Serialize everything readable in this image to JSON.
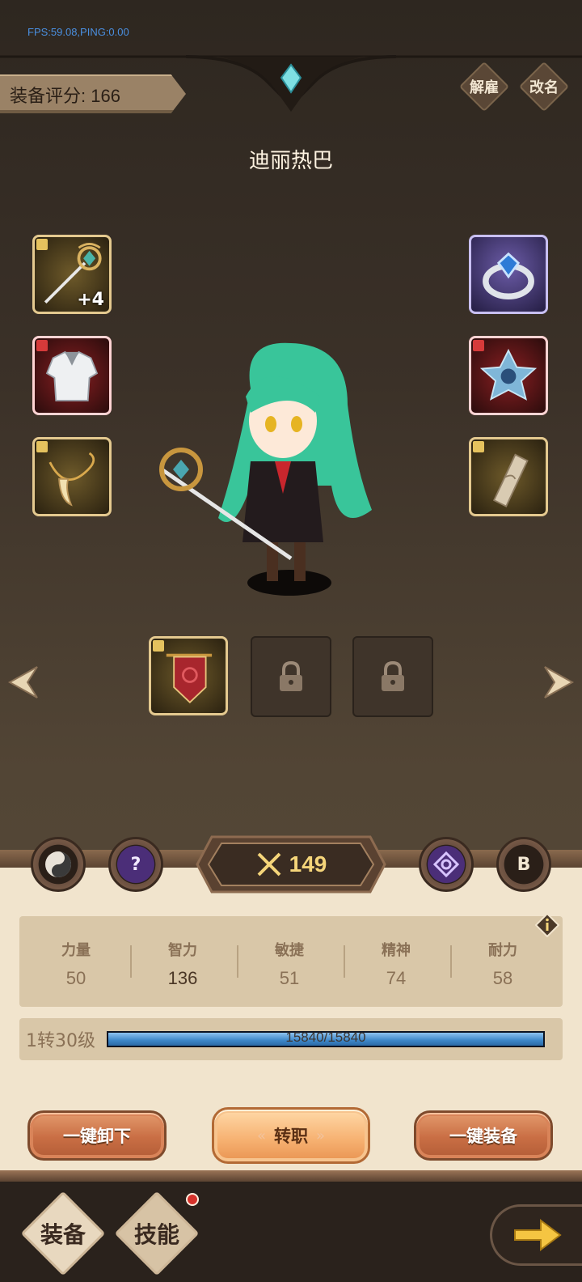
{
  "debug": {
    "fps_text": "FPS:59.08,PING:0.00"
  },
  "header": {
    "score_label": "装备评分: 166",
    "dismiss_label": "解雇",
    "rename_label": "改名",
    "hero_name": "迪丽热巴"
  },
  "equipment": {
    "weapon_enhance": "+4",
    "weapon": "staff-icon",
    "armor": "chest-armor-icon",
    "necklace": "fang-necklace-icon",
    "ring": "sapphire-ring-icon",
    "gem": "star-gem-icon",
    "bracer": "scroll-bracer-icon",
    "extra_slot_1": "banner-icon",
    "extra_slot_2": "lock-icon",
    "extra_slot_3": "lock-icon"
  },
  "round_buttons": {
    "left_1": "yinyang-icon",
    "left_2": "question-icon",
    "right_1": "rune-icon",
    "right_2_label": "B"
  },
  "power": {
    "value": "149",
    "icon": "crossed-swords-icon"
  },
  "attributes": [
    {
      "name": "力量",
      "value": "50"
    },
    {
      "name": "智力",
      "value": "136"
    },
    {
      "name": "敏捷",
      "value": "51"
    },
    {
      "name": "精神",
      "value": "74"
    },
    {
      "name": "耐力",
      "value": "58"
    }
  ],
  "level": {
    "label": "1转30级",
    "xp_text": "15840/15840",
    "xp_fraction": 1.0
  },
  "actions": {
    "unequip_all": "一键卸下",
    "change_class": "转职",
    "equip_all": "一键装备"
  },
  "nav": {
    "equip_tab": "装备",
    "skill_tab": "技能"
  },
  "colors": {
    "accent_gold": "#f5d57a",
    "xp_blue": "#3d86c8",
    "notification_red": "#d6322b"
  }
}
